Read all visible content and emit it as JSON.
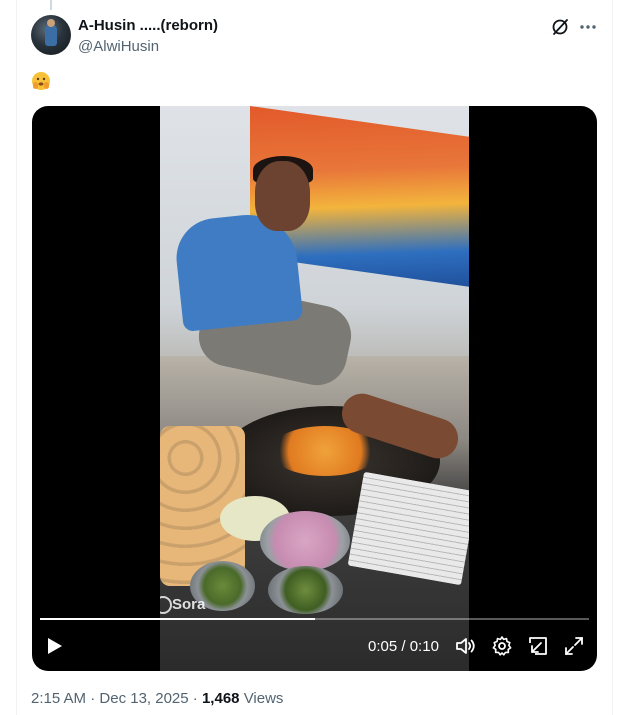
{
  "post": {
    "author_name": "A-Husin .....(reborn)",
    "author_handle": "@AlwiHusin",
    "text_emoji": "🫣",
    "timestamp": "2:15 AM",
    "separator": "·",
    "date": "Dec 13, 2025",
    "views_count": "1,468",
    "views_label": "Views"
  },
  "header_icons": [
    "grok-icon",
    "more-icon"
  ],
  "video": {
    "watermark": "Sora",
    "current_time": "0:05",
    "time_separator": " / ",
    "duration": "0:10",
    "progress_fraction": 0.5,
    "controls": [
      "play-icon",
      "volume-icon",
      "settings-icon",
      "dock-icon",
      "fullscreen-icon"
    ]
  }
}
